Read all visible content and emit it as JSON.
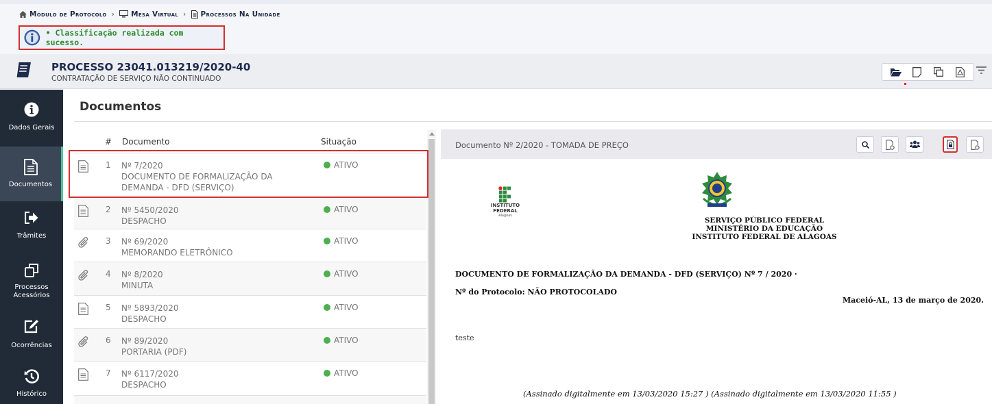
{
  "breadcrumb": {
    "items": [
      "Módulo de Protocolo",
      "Mesa Virtual",
      "Processos Na Unidade"
    ],
    "separator": "›"
  },
  "message": {
    "text": "• Classificação realizada com sucesso."
  },
  "process": {
    "title": "PROCESSO 23041.013219/2020-40",
    "subtitle": "CONTRATAÇÃO DE SERVIÇO NÃO CONTINUADO",
    "tools": [
      "folder-open-icon",
      "file-icon",
      "copy-icon",
      "pdf-icon"
    ],
    "filter_icon": "filter-icon"
  },
  "sidebar": {
    "items": [
      {
        "label": "Dados Gerais",
        "icon": "info-icon",
        "active": false
      },
      {
        "label": "Documentos",
        "icon": "document-icon",
        "active": true
      },
      {
        "label": "Trâmites",
        "icon": "sign-out-icon",
        "active": false
      },
      {
        "label": "Processos Acessórios",
        "icon": "clone-icon",
        "active": false
      },
      {
        "label": "Ocorrências",
        "icon": "edit-icon",
        "active": false
      },
      {
        "label": "Histórico",
        "icon": "history-icon",
        "active": false
      }
    ]
  },
  "documents": {
    "heading": "Documentos",
    "columns": {
      "num": "#",
      "doc": "Documento",
      "status": "Situação"
    },
    "rows": [
      {
        "n": "1",
        "num": "Nº 7/2020",
        "type": "DOCUMENTO DE FORMALIZAÇÃO DA",
        "type2": "DEMANDA - DFD (SERVIÇO)",
        "status": "ATIVO",
        "icon": "document-icon"
      },
      {
        "n": "2",
        "num": "Nº 5450/2020",
        "type": "DESPACHO",
        "status": "ATIVO",
        "icon": "document-icon"
      },
      {
        "n": "3",
        "num": "Nº 69/2020",
        "type": "MEMORANDO ELETRÔNICO",
        "status": "ATIVO",
        "icon": "paperclip-icon"
      },
      {
        "n": "4",
        "num": "Nº 8/2020",
        "type": "MINUTA",
        "status": "ATIVO",
        "icon": "paperclip-icon"
      },
      {
        "n": "5",
        "num": "Nº 5893/2020",
        "type": "DESPACHO",
        "status": "ATIVO",
        "icon": "document-icon"
      },
      {
        "n": "6",
        "num": "Nº 89/2020",
        "type": "PORTARIA (PDF)",
        "status": "ATIVO",
        "icon": "paperclip-icon"
      },
      {
        "n": "7",
        "num": "Nº 6117/2020",
        "type": "DESPACHO",
        "status": "ATIVO",
        "icon": "document-icon"
      }
    ]
  },
  "preview": {
    "title": "Documento Nº 2/2020 - TOMADA DE PREÇO",
    "buttons": [
      "search-icon",
      "file-settings-icon",
      "users-icon",
      "lock-icon",
      "file-add-icon"
    ],
    "ifal_name_1": "INSTITUTO",
    "ifal_name_2": "FEDERAL",
    "ifal_sub": "Alagoas",
    "gov_line1": "SERVIÇO PÚBLICO FEDERAL",
    "gov_line2": "MINISTÉRIO DA EDUCAÇÃO",
    "gov_line3": "INSTITUTO FEDERAL DE ALAGOAS",
    "doc_title": "DOCUMENTO DE FORMALIZAÇÃO DA DEMANDA - DFD (SERVIÇO) Nº 7 / 2020 ·",
    "protocol": "Nº do Protocolo: NÃO PROTOCOLADO",
    "date": "Maceió-AL, 13 de março de 2020.",
    "body": "teste",
    "signatures": "(Assinado digitalmente em 13/03/2020 15:27 ) (Assinado digitalmente em 13/03/2020 11:55 )"
  },
  "colors": {
    "sidebar": "#212b38",
    "accent": "#4fc3a1",
    "highlight": "#d32f2f",
    "success": "#2e8b2e",
    "status": "#4caf50"
  }
}
